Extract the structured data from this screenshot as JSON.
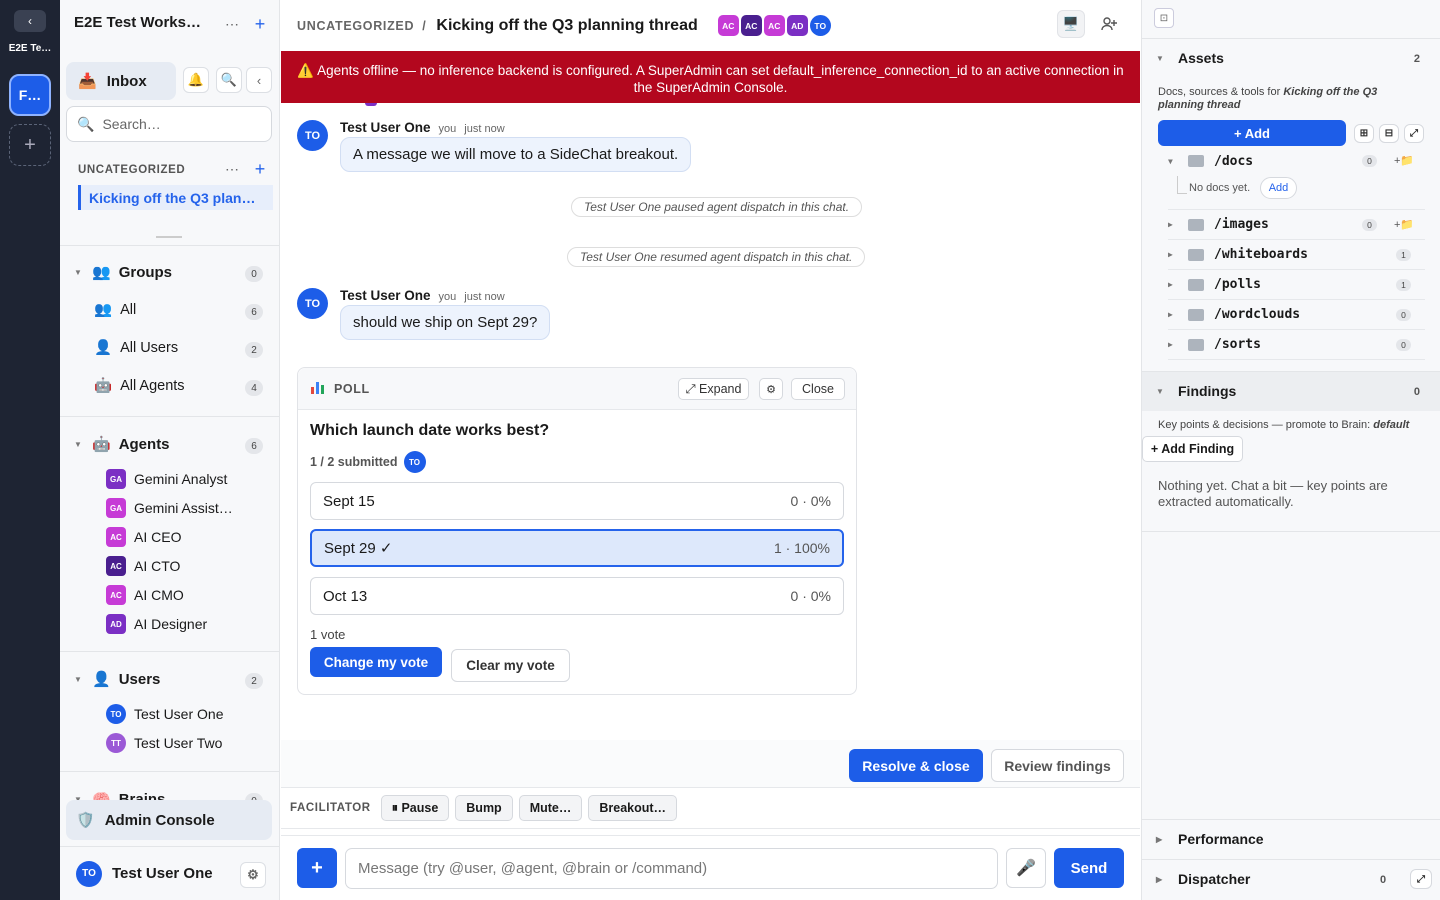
{
  "rail": {
    "back": "‹",
    "workspace_name": "E2E Te…",
    "workspace_initial": "F…",
    "add": "+"
  },
  "sidebar": {
    "title": "E2E Test Works…",
    "inbox": "Inbox",
    "search_placeholder": "Search…",
    "section": "UNCATEGORIZED",
    "active_thread": "Kicking off the Q3 plan…",
    "groups": {
      "label": "Groups",
      "count": "0",
      "items": [
        {
          "label": "All",
          "count": "6"
        },
        {
          "label": "All Users",
          "count": "2"
        },
        {
          "label": "All Agents",
          "count": "4"
        }
      ]
    },
    "agents": {
      "label": "Agents",
      "count": "6",
      "items": [
        {
          "initials": "GA",
          "label": "Gemini Analyst",
          "color": "#7b2fc4"
        },
        {
          "initials": "GA",
          "label": "Gemini Assist…",
          "color": "#c63bd6"
        },
        {
          "initials": "AC",
          "label": "AI CEO",
          "color": "#c63bd6"
        },
        {
          "initials": "AC",
          "label": "AI CTO",
          "color": "#4a1f8f"
        },
        {
          "initials": "AC",
          "label": "AI CMO",
          "color": "#c63bd6"
        },
        {
          "initials": "AD",
          "label": "AI Designer",
          "color": "#7b2fc4"
        }
      ]
    },
    "users": {
      "label": "Users",
      "count": "2",
      "items": [
        {
          "initials": "TO",
          "label": "Test User One",
          "color": "#1d5de8"
        },
        {
          "initials": "TT",
          "label": "Test User Two",
          "color": "#9b59d6"
        }
      ]
    },
    "brains": {
      "label": "Brains",
      "count": "0"
    },
    "admin": "Admin Console",
    "user": {
      "initials": "TO",
      "name": "Test User One"
    }
  },
  "main": {
    "crumb": "UNCATEGORIZED",
    "sep": "/",
    "title": "Kicking off the Q3 planning thread",
    "participants": [
      {
        "initials": "AC",
        "color": "#c63bd6"
      },
      {
        "initials": "AC",
        "color": "#4a1f8f"
      },
      {
        "initials": "AC",
        "color": "#c63bd6"
      },
      {
        "initials": "AD",
        "color": "#7b2fc4"
      },
      {
        "initials": "TO",
        "color": "#1d5de8"
      }
    ],
    "banner": "⚠️ Agents offline — no inference backend is configured. A SuperAdmin can set default_inference_connection_id to an active connection in the SuperAdmin Console.",
    "messages": [
      {
        "initials": "TO",
        "author": "Test User One",
        "you": "you",
        "time": "just now",
        "text": "A message we will move to a SideChat breakout."
      },
      {
        "initials": "TO",
        "author": "Test User One",
        "you": "you",
        "time": "just now",
        "text": "should we ship on Sept 29?"
      }
    ],
    "system": [
      "Test User One paused agent dispatch in this chat.",
      "Test User One resumed agent dispatch in this chat."
    ],
    "poll": {
      "label": "POLL",
      "expand": "⤢ Expand",
      "settings": "⚙",
      "close": "Close",
      "question": "Which launch date works best?",
      "submitted": "1 / 2 submitted",
      "submitter": "TO",
      "options": [
        {
          "label": "Sept 15",
          "result": "0 · 0%"
        },
        {
          "label": "Sept 29 ✓",
          "result": "1 · 100%"
        },
        {
          "label": "Oct 13",
          "result": "0 · 0%"
        }
      ],
      "votes": "1 vote",
      "change": "Change my vote",
      "clear": "Clear my vote"
    },
    "resolve": "Resolve & close",
    "review": "Review findings",
    "facilitator": {
      "label": "FACILITATOR",
      "buttons": [
        "⏸ Pause",
        "Bump",
        "Mute…",
        "Breakout…"
      ]
    },
    "composer": {
      "plus": "+",
      "placeholder": "Message (try @user, @agent, @brain or /command)",
      "send": "Send"
    }
  },
  "right": {
    "assets": {
      "label": "Assets",
      "count": "2",
      "desc_prefix": "Docs, sources & tools for ",
      "desc_title": "Kicking off the Q3 planning thread",
      "add": "+ Add",
      "folders": [
        {
          "name": "/docs",
          "count": "0",
          "empty": "No docs yet.",
          "add": "Add"
        },
        {
          "name": "/images",
          "count": "0"
        },
        {
          "name": "/whiteboards",
          "count": "1"
        },
        {
          "name": "/polls",
          "count": "1"
        },
        {
          "name": "/wordclouds",
          "count": "0"
        },
        {
          "name": "/sorts",
          "count": "0"
        }
      ]
    },
    "findings": {
      "label": "Findings",
      "count": "0",
      "desc": "Key points & decisions — promote to Brain:",
      "brain": "default",
      "add": "+ Add Finding",
      "empty": "Nothing yet. Chat a bit — key points are extracted automatically."
    },
    "performance": "Performance",
    "dispatcher": {
      "label": "Dispatcher",
      "count": "0"
    }
  }
}
